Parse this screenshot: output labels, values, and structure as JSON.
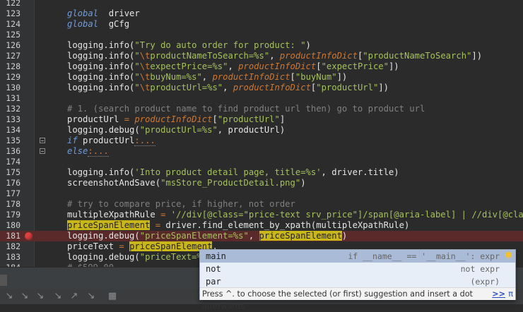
{
  "lines": [
    {
      "n": "122",
      "parts": []
    },
    {
      "n": "123",
      "parts": [
        [
          "kw",
          "global"
        ],
        [
          "",
          "  driver"
        ]
      ]
    },
    {
      "n": "124",
      "parts": [
        [
          "kw",
          "global"
        ],
        [
          "",
          "  gCfg"
        ]
      ]
    },
    {
      "n": "125",
      "parts": []
    },
    {
      "n": "126",
      "parts": [
        [
          "",
          "logging.info("
        ],
        [
          "str",
          "\"Try do auto order for product: \""
        ],
        [
          "",
          ")"
        ]
      ]
    },
    {
      "n": "127",
      "parts": [
        [
          "",
          "logging.info("
        ],
        [
          "str",
          "\""
        ],
        [
          "esc",
          "\\t"
        ],
        [
          "str",
          "productNameToSearch=%s\""
        ],
        [
          "",
          ", "
        ],
        [
          "gv",
          "productInfoDict"
        ],
        [
          "",
          "["
        ],
        [
          "str",
          "\"productNameToSearch\""
        ],
        [
          "",
          "])"
        ]
      ]
    },
    {
      "n": "128",
      "parts": [
        [
          "",
          "logging.info("
        ],
        [
          "str",
          "\""
        ],
        [
          "esc",
          "\\t"
        ],
        [
          "str",
          "expectPrice=%s\""
        ],
        [
          "",
          ", "
        ],
        [
          "gv",
          "productInfoDict"
        ],
        [
          "",
          "["
        ],
        [
          "str",
          "\"expectPrice\""
        ],
        [
          "",
          "])"
        ]
      ]
    },
    {
      "n": "129",
      "parts": [
        [
          "",
          "logging.info("
        ],
        [
          "str",
          "\""
        ],
        [
          "esc",
          "\\t"
        ],
        [
          "str",
          "buyNum=%s\""
        ],
        [
          "",
          ", "
        ],
        [
          "gv",
          "productInfoDict"
        ],
        [
          "",
          "["
        ],
        [
          "str",
          "\"buyNum\""
        ],
        [
          "",
          "])"
        ]
      ]
    },
    {
      "n": "130",
      "parts": [
        [
          "",
          "logging.info("
        ],
        [
          "str",
          "\""
        ],
        [
          "esc",
          "\\t"
        ],
        [
          "str",
          "productUrl=%s\""
        ],
        [
          "",
          ", "
        ],
        [
          "gv",
          "productInfoDict"
        ],
        [
          "",
          "["
        ],
        [
          "str",
          "\"productUrl\""
        ],
        [
          "",
          "])"
        ]
      ]
    },
    {
      "n": "131",
      "parts": []
    },
    {
      "n": "132",
      "parts": [
        [
          "cm",
          "# 1. (search product name to find product url then) go to product url"
        ]
      ]
    },
    {
      "n": "133",
      "parts": [
        [
          "",
          "productUrl "
        ],
        [
          "op",
          "="
        ],
        [
          "",
          ""
        ],
        [
          "gv",
          " productInfoDict"
        ],
        [
          "",
          "["
        ],
        [
          "str",
          "\"productUrl\""
        ],
        [
          "",
          "]"
        ]
      ]
    },
    {
      "n": "134",
      "parts": [
        [
          "",
          "logging.debug("
        ],
        [
          "str",
          "\"productUrl=%s\""
        ],
        [
          "",
          ", productUrl)"
        ]
      ]
    },
    {
      "n": "135",
      "fold": true,
      "parts": [
        [
          "kw",
          "if"
        ],
        [
          "",
          " productUrl"
        ],
        [
          "dots",
          ":..."
        ]
      ]
    },
    {
      "n": "136",
      "fold": true,
      "parts": [
        [
          "kw",
          "else"
        ],
        [
          "dots",
          ":..."
        ]
      ]
    },
    {
      "n": "174",
      "parts": []
    },
    {
      "n": "175",
      "parts": [
        [
          "",
          "logging.info("
        ],
        [
          "str",
          "'Into product detail page, title=%s'"
        ],
        [
          "",
          ", driver.title)"
        ]
      ]
    },
    {
      "n": "176",
      "parts": [
        [
          "",
          "screenshotAndSave("
        ],
        [
          "str",
          "\"msStore_ProductDetail.png\""
        ],
        [
          "",
          ")"
        ]
      ]
    },
    {
      "n": "177",
      "parts": []
    },
    {
      "n": "178",
      "parts": [
        [
          "cm",
          "# try to compare price, if higher, not order"
        ]
      ]
    },
    {
      "n": "179",
      "parts": [
        [
          "",
          "multipleXpathRule "
        ],
        [
          "op",
          "="
        ],
        [
          "str",
          " '//div[@class=\"price-text srv_price\"]/span[@aria-label] | //div[@class=\""
        ]
      ]
    },
    {
      "n": "180",
      "parts": [
        [
          "hl",
          "priceSpanElement"
        ],
        [
          "",
          " "
        ],
        [
          "op",
          "="
        ],
        [
          "",
          " driver.find_element_by_xpath(multipleXpathRule)"
        ]
      ]
    },
    {
      "n": "181",
      "bp": true,
      "parts": [
        [
          "",
          "logging.debug("
        ],
        [
          "str",
          "\"priceSpanElement=%s\""
        ],
        [
          "",
          ", "
        ],
        [
          "hl",
          "priceSpanElement"
        ],
        [
          "",
          ")"
        ]
      ]
    },
    {
      "n": "182",
      "parts": [
        [
          "",
          "priceText "
        ],
        [
          "op",
          "="
        ],
        [
          "",
          " "
        ],
        [
          "hl",
          "priceSpanElement"
        ],
        [
          "",
          "."
        ]
      ]
    },
    {
      "n": "183",
      "parts": [
        [
          "",
          "logging.debug("
        ],
        [
          "str",
          "\"priceText=%s"
        ]
      ]
    },
    {
      "n": "184",
      "parts": [
        [
          "cm",
          "# $599.00"
        ]
      ]
    }
  ],
  "popup": {
    "items": [
      {
        "name": "main",
        "desc": "if __name__ == '__main__': expr",
        "selected": true
      },
      {
        "name": "not",
        "desc": "not expr",
        "selected": false
      },
      {
        "name": "par",
        "desc": "(expr)",
        "selected": false
      }
    ],
    "footer": "Press ^. to choose the selected (or first) suggestion and insert a dot afterwards",
    "link": ">>",
    "pi": "π"
  },
  "colors": {
    "background": "#2b2b2b",
    "string": "#a5c25c",
    "keyword": "#cc7832",
    "highlight": "#c9b71a",
    "breakpoint": "#e04040"
  }
}
